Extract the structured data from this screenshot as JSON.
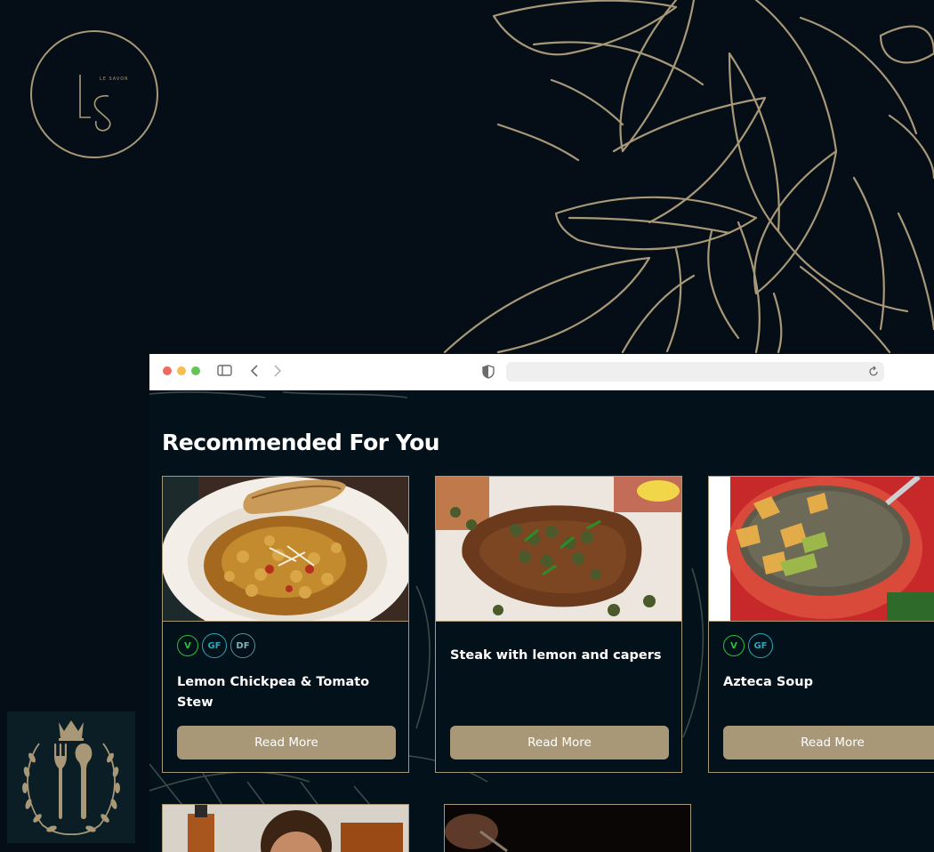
{
  "brand": {
    "logo_monogram": "LS",
    "logo_wordmark": "LE SAVOR"
  },
  "browser": {
    "url": "",
    "icons": [
      "sidebar-icon",
      "chevron-left-icon",
      "chevron-right-icon",
      "shield-icon",
      "reload-icon"
    ]
  },
  "section": {
    "title": "Recommended For You"
  },
  "recipes": [
    {
      "title": "Lemon Chickpea & Tomato Stew",
      "tags": [
        "V",
        "GF",
        "DF"
      ],
      "button_label": "Read More"
    },
    {
      "title": "Steak with lemon and capers",
      "tags": [],
      "button_label": "Read More"
    },
    {
      "title": "Azteca Soup",
      "tags": [
        "V",
        "GF"
      ],
      "button_label": "Read More"
    }
  ],
  "colors": {
    "background": "#050e17",
    "accent_gold": "#a89877",
    "tag_vegan": "#2ebf3a",
    "tag_gluten_free": "#2aa7b8",
    "tag_dairy_free": "#5e8d93"
  }
}
